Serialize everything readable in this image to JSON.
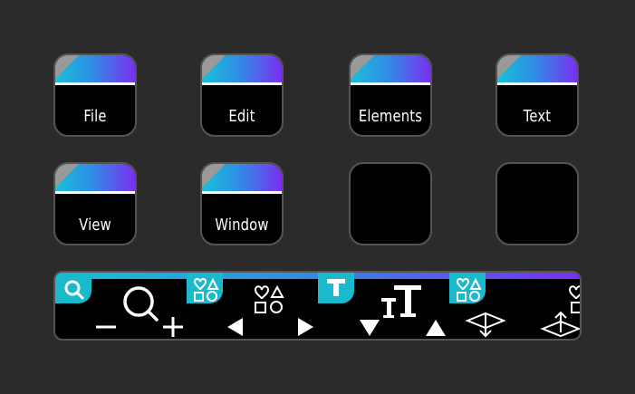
{
  "keys": [
    {
      "label": "File"
    },
    {
      "label": "Edit"
    },
    {
      "label": "Elements"
    },
    {
      "label": "Text"
    },
    {
      "label": "View"
    },
    {
      "label": "Window"
    },
    {
      "label": ""
    },
    {
      "label": ""
    }
  ],
  "dial_strip": {
    "segments": [
      {
        "name": "zoom",
        "tab_icon": "search-icon",
        "left_icon": "minus-icon",
        "center_icon": "magnifier-icon",
        "right_icon": "plus-icon"
      },
      {
        "name": "shapes",
        "tab_icon": "shapes-icon",
        "left_icon": "arrow-left-icon",
        "center_icon": "shapes-icon",
        "right_icon": "arrow-right-icon"
      },
      {
        "name": "text-size",
        "tab_icon": "text-T-icon",
        "left_icon": "triangle-down-icon",
        "center_icon": "text-size-icon",
        "right_icon": "triangle-up-icon"
      },
      {
        "name": "shape-arrange",
        "tab_icon": "shapes-icon",
        "left_icon": "send-backward-icon",
        "center_icon": "shapes-icon",
        "right_icon": "bring-forward-icon"
      }
    ]
  },
  "colors": {
    "background": "#2b2b2b",
    "key_face": "#000000",
    "key_border": "#555555",
    "gradient_start": "#18c0d6",
    "gradient_end": "#7a2ff0",
    "tab_cyan": "#1ab9cc"
  }
}
